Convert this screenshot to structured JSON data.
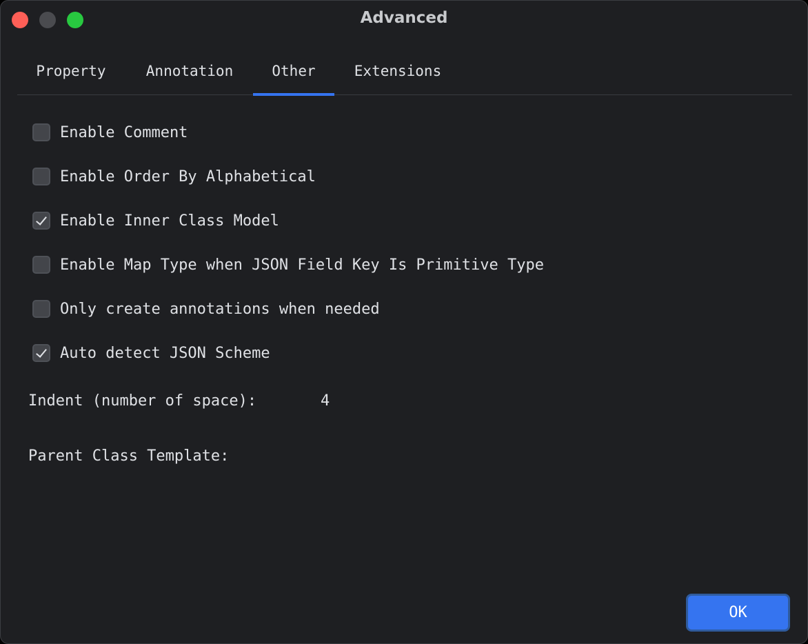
{
  "window": {
    "title": "Advanced",
    "controls": [
      "close",
      "minimize",
      "zoom"
    ]
  },
  "tabs": [
    {
      "label": "Property",
      "active": false
    },
    {
      "label": "Annotation",
      "active": false
    },
    {
      "label": "Other",
      "active": true
    },
    {
      "label": "Extensions",
      "active": false
    }
  ],
  "options": [
    {
      "label": "Enable Comment",
      "checked": false
    },
    {
      "label": "Enable Order By Alphabetical",
      "checked": false
    },
    {
      "label": "Enable Inner Class Model",
      "checked": true
    },
    {
      "label": "Enable Map Type when JSON Field Key Is Primitive Type",
      "checked": false
    },
    {
      "label": "Only create annotations when needed",
      "checked": false
    },
    {
      "label": "Auto detect JSON Scheme",
      "checked": true
    }
  ],
  "indent": {
    "label": "Indent (number of space):",
    "value": "4"
  },
  "parent_class_template": {
    "label": "Parent Class Template:"
  },
  "ok_button": {
    "label": "OK"
  },
  "colors": {
    "background": "#1e1f22",
    "accent": "#3574f0",
    "text": "#dfe1e5",
    "close": "#fe5f57",
    "zoom": "#28c840"
  }
}
